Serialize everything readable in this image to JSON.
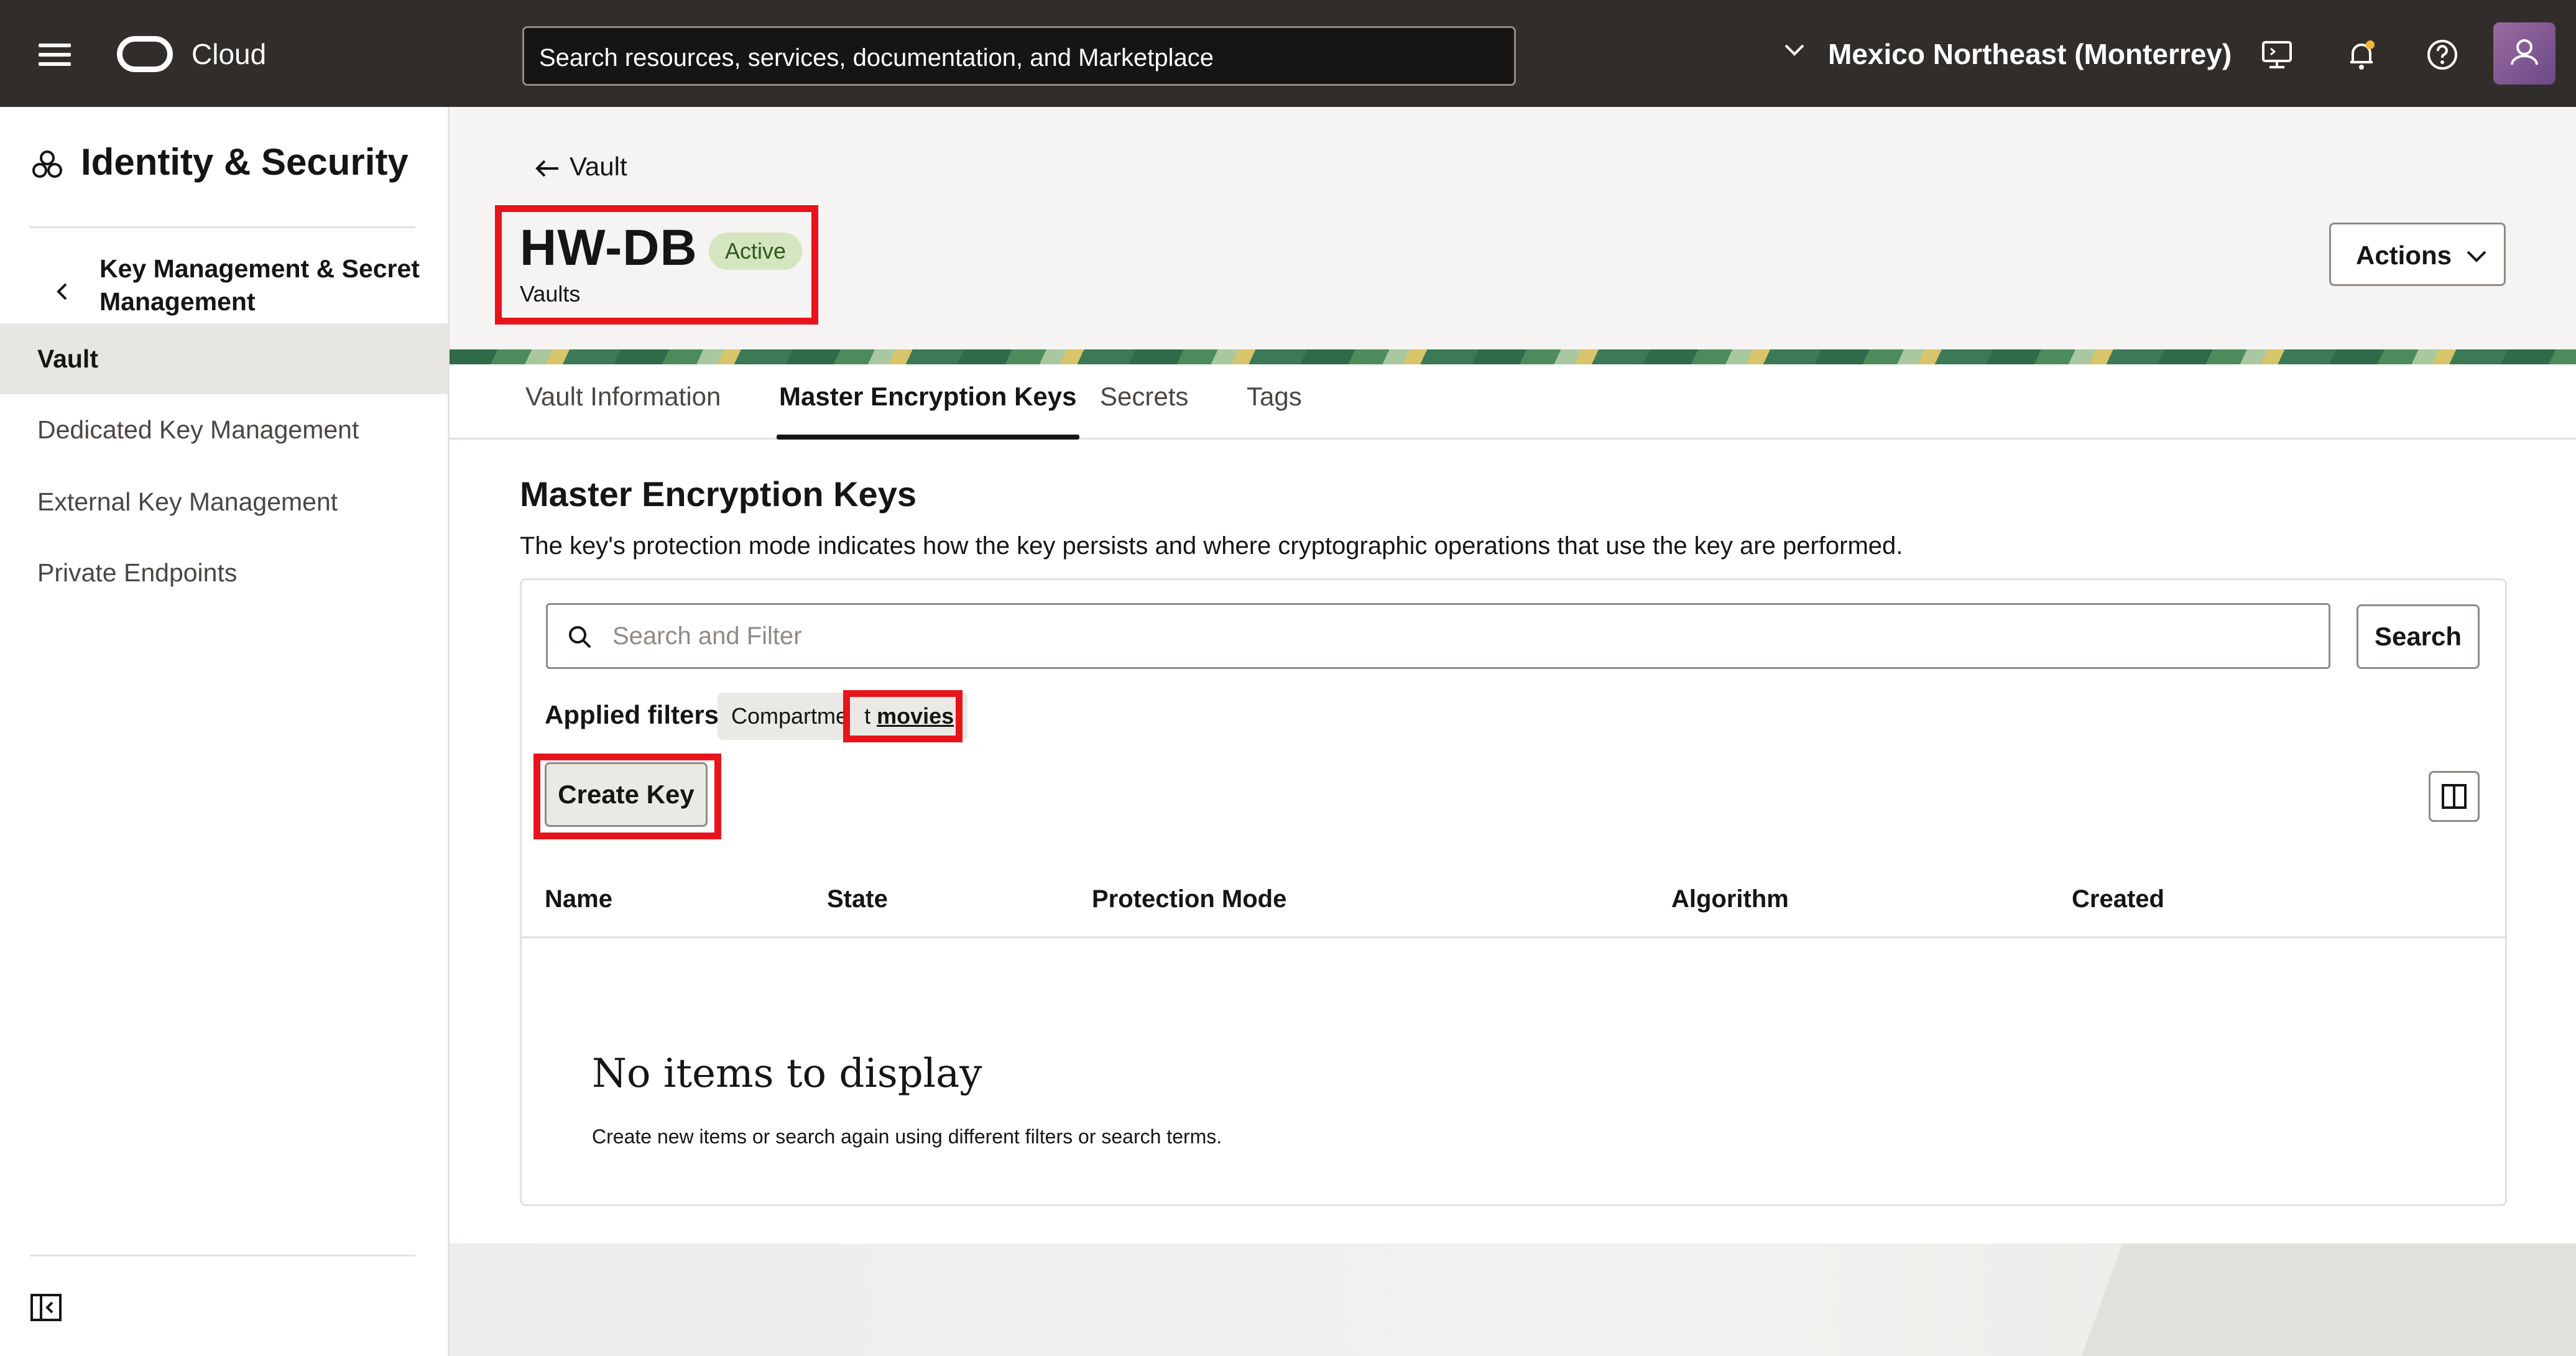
{
  "topbar": {
    "brand": "Cloud",
    "search_placeholder": "Search resources, services, documentation, and Marketplace",
    "region": "Mexico Northeast (Monterrey)"
  },
  "sidebar": {
    "title": "Identity & Security",
    "section": "Key Management & Secret Management",
    "items": [
      {
        "label": "Vault",
        "active": true
      },
      {
        "label": "Dedicated Key Management"
      },
      {
        "label": "External Key Management"
      },
      {
        "label": "Private Endpoints"
      }
    ]
  },
  "header": {
    "back_label": "Vault",
    "title": "HW-DB",
    "status": "Active",
    "subtitle": "Vaults",
    "actions_label": "Actions"
  },
  "tabs": [
    {
      "label": "Vault Information"
    },
    {
      "label": "Master Encryption Keys",
      "active": true
    },
    {
      "label": "Secrets"
    },
    {
      "label": "Tags"
    }
  ],
  "keys": {
    "title": "Master Encryption Keys",
    "description": "The key's protection mode indicates how the key persists and where cryptographic operations that use the key are performed.",
    "filter_placeholder": "Search and Filter",
    "search_label": "Search",
    "applied_filters_label": "Applied filters",
    "chip_label_left": "Compartme",
    "chip_label_right": "t",
    "chip_value": "movies",
    "create_label": "Create Key",
    "columns": [
      "Name",
      "State",
      "Protection Mode",
      "Algorithm",
      "Created"
    ],
    "empty_title": "No items to display",
    "empty_desc": "Create new items or search again using different filters or search terms."
  },
  "colors": {
    "topbar": "#312d2a",
    "highlight": "#e8141c",
    "status_bg": "#d4e6c0"
  }
}
